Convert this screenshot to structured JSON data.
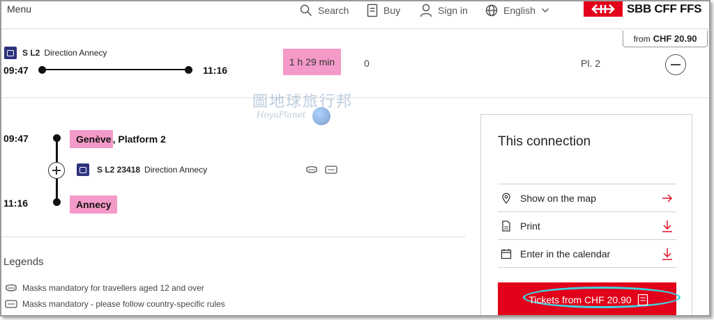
{
  "header": {
    "menu_label": "Menu",
    "search_label": "Search",
    "buy_label": "Buy",
    "signin_label": "Sign in",
    "language_label": "English",
    "logo_text": "SBB CFF FFS"
  },
  "summary": {
    "from_prefix": "from",
    "from_price": "CHF 20.90",
    "line": "S L2",
    "direction": "Direction Annecy",
    "departure": "09:47",
    "arrival": "11:16",
    "duration": "1 h 29 min",
    "changes": "0",
    "platform": "Pl. 2"
  },
  "watermark": {
    "chinese": "圖地球旅行邦",
    "latin": "HoyaPlanet"
  },
  "detail": {
    "dep_time": "09:47",
    "dep_station": "Genève",
    "dep_platform": ", Platform 2",
    "train_number": "S L2 23418",
    "direction": "Direction Annecy",
    "arr_time": "11:16",
    "arr_station": "Annecy"
  },
  "legends": {
    "title": "Legends",
    "items": [
      "Masks mandatory for travellers aged 12 and over",
      "Masks mandatory - please follow country-specific rules"
    ]
  },
  "panel": {
    "title": "This connection",
    "map_label": "Show on the map",
    "print_label": "Print",
    "calendar_label": "Enter in the calendar",
    "ticket_label": "Tickets from CHF 20.90"
  },
  "colors": {
    "brand_red": "#e2001a",
    "highlight_pink": "#f49ac8",
    "train_blue": "#2d327d",
    "annotation_cyan": "#3dd5e0"
  }
}
